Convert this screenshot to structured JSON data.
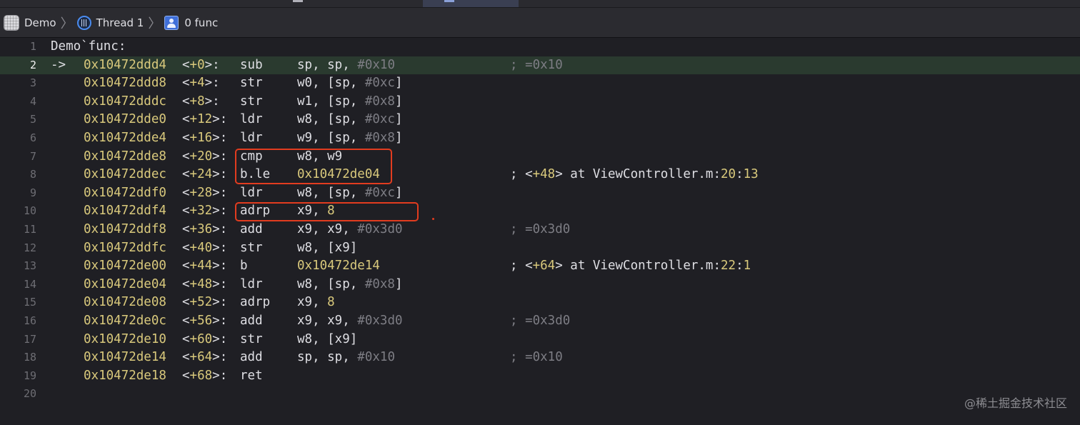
{
  "tabbar": {},
  "jumpbar": {
    "crumbs": [
      {
        "label": "Demo",
        "icon": "app-icon"
      },
      {
        "label": "Thread 1",
        "icon": "thread-icon"
      },
      {
        "label": "0 func",
        "icon": "stack-frame-icon"
      }
    ]
  },
  "editor": {
    "current_line": 2,
    "pc_arrow": "->",
    "header": "Demo`func:",
    "instructions": [
      {
        "addr": "0x10472ddd4",
        "offset": "+0",
        "mnemonic": "sub",
        "ops": [
          [
            "",
            "sp, sp, "
          ],
          [
            "imm",
            "#0x10"
          ]
        ],
        "comment": "; =0x10",
        "comment_kind": "plain"
      },
      {
        "addr": "0x10472ddd8",
        "offset": "+4",
        "mnemonic": "str",
        "ops": [
          [
            "",
            "w0, [sp, "
          ],
          [
            "imm",
            "#0xc"
          ],
          [
            "",
            "]"
          ]
        ],
        "comment": "",
        "comment_kind": "plain"
      },
      {
        "addr": "0x10472dddc",
        "offset": "+8",
        "mnemonic": "str",
        "ops": [
          [
            "",
            "w1, [sp, "
          ],
          [
            "imm",
            "#0x8"
          ],
          [
            "",
            "]"
          ]
        ],
        "comment": "",
        "comment_kind": "plain"
      },
      {
        "addr": "0x10472dde0",
        "offset": "+12",
        "mnemonic": "ldr",
        "ops": [
          [
            "",
            "w8, [sp, "
          ],
          [
            "imm",
            "#0xc"
          ],
          [
            "",
            "]"
          ]
        ],
        "comment": "",
        "comment_kind": "plain"
      },
      {
        "addr": "0x10472dde4",
        "offset": "+16",
        "mnemonic": "ldr",
        "ops": [
          [
            "",
            "w9, [sp, "
          ],
          [
            "imm",
            "#0x8"
          ],
          [
            "",
            "]"
          ]
        ],
        "comment": "",
        "comment_kind": "plain"
      },
      {
        "addr": "0x10472dde8",
        "offset": "+20",
        "mnemonic": "cmp",
        "ops": [
          [
            "",
            "w8, w9"
          ]
        ],
        "comment": "",
        "comment_kind": "plain"
      },
      {
        "addr": "0x10472ddec",
        "offset": "+24",
        "mnemonic": "b.le",
        "ops": [
          [
            "num",
            "0x10472de04"
          ]
        ],
        "comment": "; <+48> at ViewController.m:20:13",
        "comment_kind": "loc",
        "comment_parts": [
          [
            "",
            "; <"
          ],
          [
            "num",
            "+48"
          ],
          [
            "",
            "> at ViewController.m:"
          ],
          [
            "num",
            "20"
          ],
          [
            "",
            ":"
          ],
          [
            "num",
            "13"
          ]
        ]
      },
      {
        "addr": "0x10472ddf0",
        "offset": "+28",
        "mnemonic": "ldr",
        "ops": [
          [
            "",
            "w8, [sp, "
          ],
          [
            "imm",
            "#0xc"
          ],
          [
            "",
            "]"
          ]
        ],
        "comment": "",
        "comment_kind": "plain"
      },
      {
        "addr": "0x10472ddf4",
        "offset": "+32",
        "mnemonic": "adrp",
        "ops": [
          [
            "",
            "x9, "
          ],
          [
            "num",
            "8"
          ]
        ],
        "comment": "",
        "comment_kind": "plain"
      },
      {
        "addr": "0x10472ddf8",
        "offset": "+36",
        "mnemonic": "add",
        "ops": [
          [
            "",
            "x9, x9, "
          ],
          [
            "imm",
            "#0x3d0"
          ]
        ],
        "comment": "; =0x3d0",
        "comment_kind": "plain"
      },
      {
        "addr": "0x10472ddfc",
        "offset": "+40",
        "mnemonic": "str",
        "ops": [
          [
            "",
            "w8, [x9]"
          ]
        ],
        "comment": "",
        "comment_kind": "plain"
      },
      {
        "addr": "0x10472de00",
        "offset": "+44",
        "mnemonic": "b",
        "ops": [
          [
            "num",
            "0x10472de14"
          ]
        ],
        "comment": "; <+64> at ViewController.m:22:1",
        "comment_kind": "loc",
        "comment_parts": [
          [
            "",
            "; <"
          ],
          [
            "num",
            "+64"
          ],
          [
            "",
            "> at ViewController.m:"
          ],
          [
            "num",
            "22"
          ],
          [
            "",
            ":"
          ],
          [
            "num",
            "1"
          ]
        ]
      },
      {
        "addr": "0x10472de04",
        "offset": "+48",
        "mnemonic": "ldr",
        "ops": [
          [
            "",
            "w8, [sp, "
          ],
          [
            "imm",
            "#0x8"
          ],
          [
            "",
            "]"
          ]
        ],
        "comment": "",
        "comment_kind": "plain"
      },
      {
        "addr": "0x10472de08",
        "offset": "+52",
        "mnemonic": "adrp",
        "ops": [
          [
            "",
            "x9, "
          ],
          [
            "num",
            "8"
          ]
        ],
        "comment": "",
        "comment_kind": "plain"
      },
      {
        "addr": "0x10472de0c",
        "offset": "+56",
        "mnemonic": "add",
        "ops": [
          [
            "",
            "x9, x9, "
          ],
          [
            "imm",
            "#0x3d0"
          ]
        ],
        "comment": "; =0x3d0",
        "comment_kind": "plain"
      },
      {
        "addr": "0x10472de10",
        "offset": "+60",
        "mnemonic": "str",
        "ops": [
          [
            "",
            "w8, [x9]"
          ]
        ],
        "comment": "",
        "comment_kind": "plain"
      },
      {
        "addr": "0x10472de14",
        "offset": "+64",
        "mnemonic": "add",
        "ops": [
          [
            "",
            "sp, sp, "
          ],
          [
            "imm",
            "#0x10"
          ]
        ],
        "comment": "; =0x10",
        "comment_kind": "plain"
      },
      {
        "addr": "0x10472de18",
        "offset": "+68",
        "mnemonic": "ret",
        "ops": [],
        "comment": "",
        "comment_kind": "plain"
      }
    ],
    "line_numbers": [
      "1",
      "2",
      "3",
      "4",
      "5",
      "6",
      "7",
      "8",
      "9",
      "10",
      "11",
      "12",
      "13",
      "14",
      "15",
      "16",
      "17",
      "18",
      "19",
      "20"
    ]
  },
  "annotations": {
    "highlight_color": "#e23c1f"
  },
  "watermark": "@稀土掘金技术社区",
  "colors": {
    "background": "#1f1f24",
    "address": "#d9c97c",
    "immediate": "#7d7d84",
    "current_line_bg": "#2a3a2f"
  }
}
